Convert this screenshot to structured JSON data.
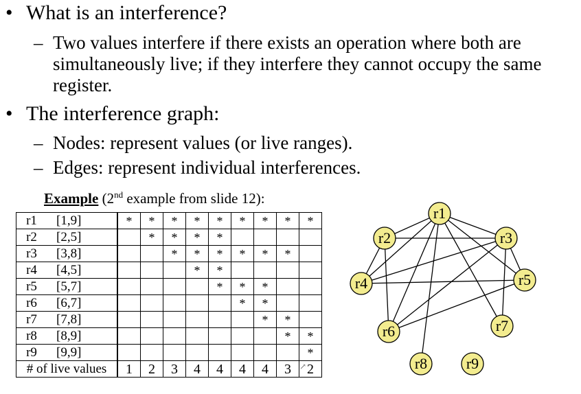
{
  "bullets": [
    {
      "symbol": "•",
      "text": "What is an interference?",
      "sub": [
        {
          "dash": "–",
          "lines": [
            "Two values interfere if there exists an operation where both are",
            "simultaneously live; if they interfere they cannot occupy the same",
            "register."
          ]
        }
      ]
    },
    {
      "symbol": "•",
      "text": "The interference graph:",
      "sub": [
        {
          "dash": "–",
          "lines": [
            "Nodes: represent values (or live ranges)."
          ]
        },
        {
          "dash": "–",
          "lines": [
            "Edges: represent individual interferences."
          ]
        }
      ]
    }
  ],
  "example": {
    "label": "Example",
    "text_before_sup": "(2",
    "sup": "nd",
    "text_after_sup": " example from slide 12):"
  },
  "table": {
    "rows": [
      {
        "reg": "r1",
        "range": "[1,9]",
        "cells": [
          "*",
          "*",
          "*",
          "*",
          "*",
          "*",
          "*",
          "*",
          "*"
        ]
      },
      {
        "reg": "r2",
        "range": "[2,5]",
        "cells": [
          "",
          "*",
          "*",
          "*",
          "*",
          "",
          "",
          "",
          ""
        ]
      },
      {
        "reg": "r3",
        "range": "[3,8]",
        "cells": [
          "",
          "",
          "*",
          "*",
          "*",
          "*",
          "*",
          "*",
          ""
        ]
      },
      {
        "reg": "r4",
        "range": "[4,5]",
        "cells": [
          "",
          "",
          "",
          "*",
          "*",
          "",
          "",
          "",
          ""
        ]
      },
      {
        "reg": "r5",
        "range": "[5,7]",
        "cells": [
          "",
          "",
          "",
          "",
          "*",
          "*",
          "*",
          "",
          ""
        ]
      },
      {
        "reg": "r6",
        "range": "[6,7]",
        "cells": [
          "",
          "",
          "",
          "",
          "",
          "*",
          "*",
          "",
          ""
        ]
      },
      {
        "reg": "r7",
        "range": "[7,8]",
        "cells": [
          "",
          "",
          "",
          "",
          "",
          "",
          "*",
          "*",
          ""
        ]
      },
      {
        "reg": "r8",
        "range": "[8,9]",
        "cells": [
          "",
          "",
          "",
          "",
          "",
          "",
          "",
          "*",
          "*"
        ]
      },
      {
        "reg": "r9",
        "range": "[9,9]",
        "cells": [
          "",
          "",
          "",
          "",
          "",
          "",
          "",
          "",
          "*"
        ]
      }
    ],
    "footer": {
      "label": "# of live values",
      "values": [
        "1",
        "2",
        "3",
        "4",
        "4",
        "4",
        "4",
        "3",
        "2"
      ]
    }
  },
  "graph": {
    "node_color": "#f3ec8f",
    "nodes": [
      {
        "id": "r1",
        "label": "r1"
      },
      {
        "id": "r2",
        "label": "r2"
      },
      {
        "id": "r3",
        "label": "r3"
      },
      {
        "id": "r4",
        "label": "r4"
      },
      {
        "id": "r5",
        "label": "r5"
      },
      {
        "id": "r6",
        "label": "r6"
      },
      {
        "id": "r7",
        "label": "r7"
      },
      {
        "id": "r8",
        "label": "r8"
      },
      {
        "id": "r9",
        "label": "r9"
      }
    ],
    "edges": [
      [
        "r1",
        "r2"
      ],
      [
        "r1",
        "r3"
      ],
      [
        "r1",
        "r4"
      ],
      [
        "r1",
        "r5"
      ],
      [
        "r1",
        "r6"
      ],
      [
        "r1",
        "r7"
      ],
      [
        "r1",
        "r8"
      ],
      [
        "r2",
        "r3"
      ],
      [
        "r2",
        "r4"
      ],
      [
        "r2",
        "r6"
      ],
      [
        "r3",
        "r4"
      ],
      [
        "r3",
        "r5"
      ],
      [
        "r3",
        "r6"
      ],
      [
        "r3",
        "r7"
      ],
      [
        "r4",
        "r5"
      ],
      [
        "r5",
        "r6"
      ]
    ]
  }
}
